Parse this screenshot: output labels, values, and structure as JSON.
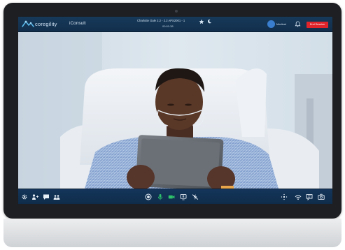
{
  "topbar": {
    "brand": "coregility",
    "app_name": "iConsult",
    "room_title": "Charlotte Gale 2.2 - 2.2 APS2001 - 1",
    "timer": "00:01:38",
    "user_name": "Medical",
    "end_session_label": "End Session"
  },
  "toolbar": {
    "left": [
      "gear-icon",
      "add-person-icon",
      "chat-icon",
      "participants-icon"
    ],
    "center": [
      "record-icon",
      "mic-icon",
      "camera-icon",
      "share-screen-icon",
      "no-flash-icon"
    ],
    "right": [
      "pan-icon",
      "network-icon",
      "caption-icon",
      "snapshot-icon"
    ]
  },
  "colors": {
    "bezel": "#1d1f22",
    "bar": "#14355a",
    "end_session": "#e0242b",
    "mic_active": "#2ec36b",
    "camera_active": "#2ec36b"
  }
}
